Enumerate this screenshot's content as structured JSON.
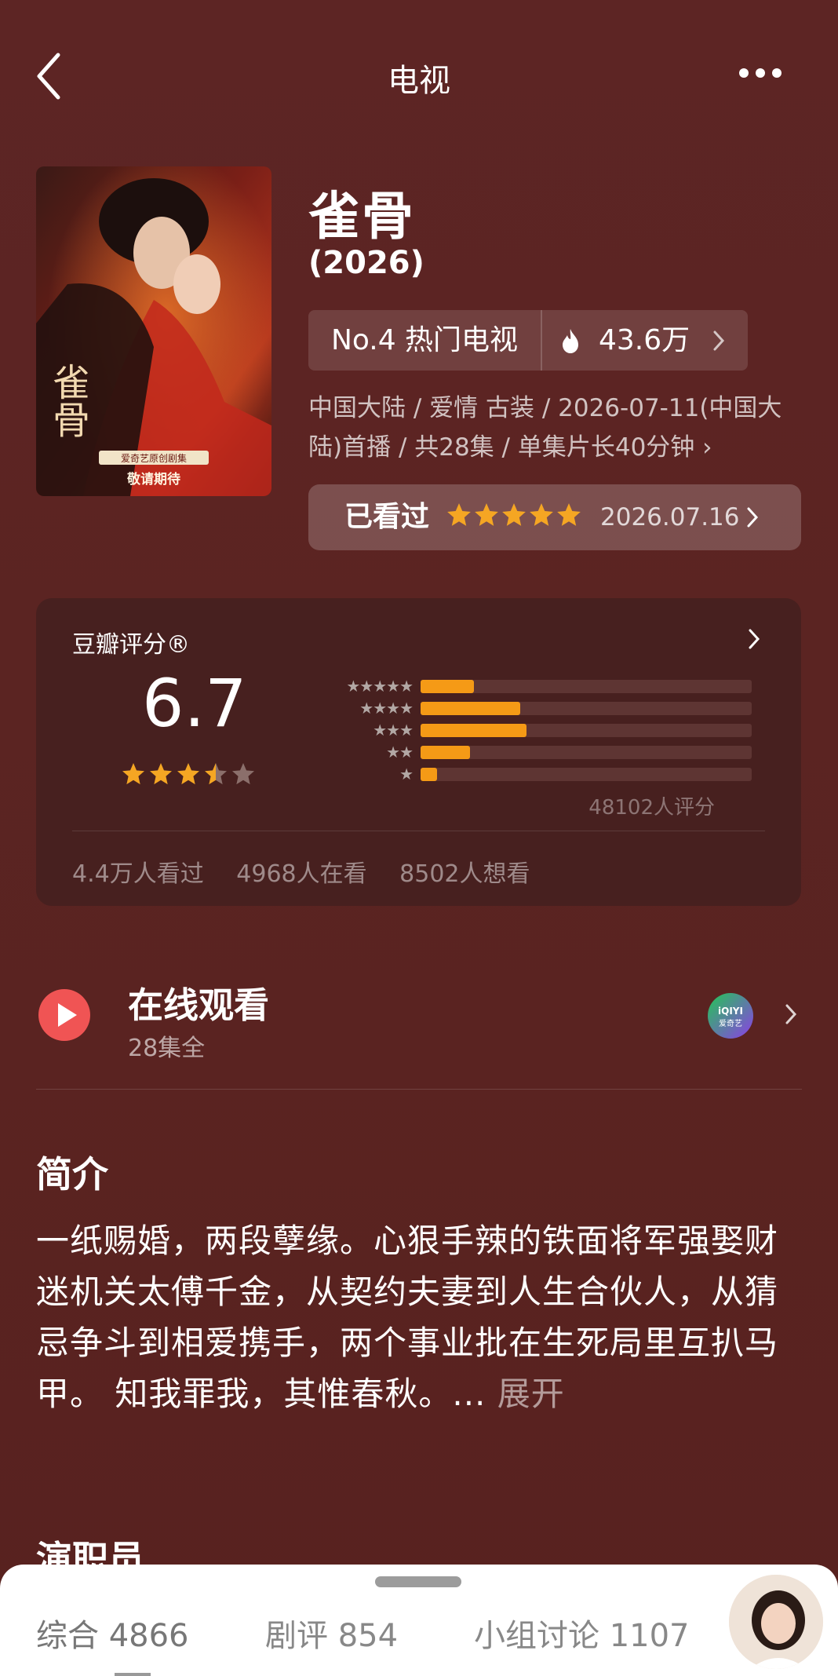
{
  "header": {
    "title": "电视",
    "back_icon": "chevron-left-icon",
    "more_icon": "more-horizontal-icon"
  },
  "poster": {
    "caption_brand": "爱奇艺原创剧集",
    "caption_status": "敬请期待",
    "title_glyphs": "雀骨"
  },
  "show": {
    "title": "雀骨",
    "year": "(2026)",
    "rank_label": "No.4 热门电视",
    "heat_value": "43.6万",
    "meta": "中国大陆 / 爱情 古装 / 2026-07-11(中国大陆)首播 / 共28集 / 单集片长40分钟 ›"
  },
  "watched": {
    "label": "已看过",
    "stars": 5,
    "date": "2026.07.16"
  },
  "rating": {
    "title": "豆瓣评分®",
    "score": "6.7",
    "stars": 3.5,
    "distribution": [
      {
        "stars": 5,
        "label": "★★★★★",
        "value": 0.16
      },
      {
        "stars": 4,
        "label": "★★★★",
        "value": 0.3
      },
      {
        "stars": 3,
        "label": "★★★",
        "value": 0.32
      },
      {
        "stars": 2,
        "label": "★★",
        "value": 0.15
      },
      {
        "stars": 1,
        "label": "★",
        "value": 0.05
      }
    ],
    "count_text": "48102人评分",
    "stats": {
      "watched": "4.4万人看过",
      "watching": "4968人在看",
      "want": "8502人想看"
    }
  },
  "online": {
    "title": "在线观看",
    "subtitle": "28集全",
    "platform_icon": "iqiyi-icon",
    "platform_text": "iQIYI",
    "platform_text_cn": "爱奇艺"
  },
  "synopsis": {
    "title": "简介",
    "text": "一纸赐婚，两段孽缘。心狠手辣的铁面将军强娶财迷机关太傅千金，从契约夫妻到人生合伙人，从猜忌争斗到相爱携手，两个事业批在生死局里互扒马甲。 知我罪我，其惟春秋。... ",
    "more_label": "展开"
  },
  "cast": {
    "title": "演职员"
  },
  "bottom_tabs": [
    {
      "label": "综合 4866"
    },
    {
      "label": "剧评 854"
    },
    {
      "label": "小组讨论 1107"
    }
  ],
  "colors": {
    "background": "#5a2423",
    "card": "#47201f",
    "accent_orange": "#f59a16",
    "play_red": "#f05454"
  }
}
